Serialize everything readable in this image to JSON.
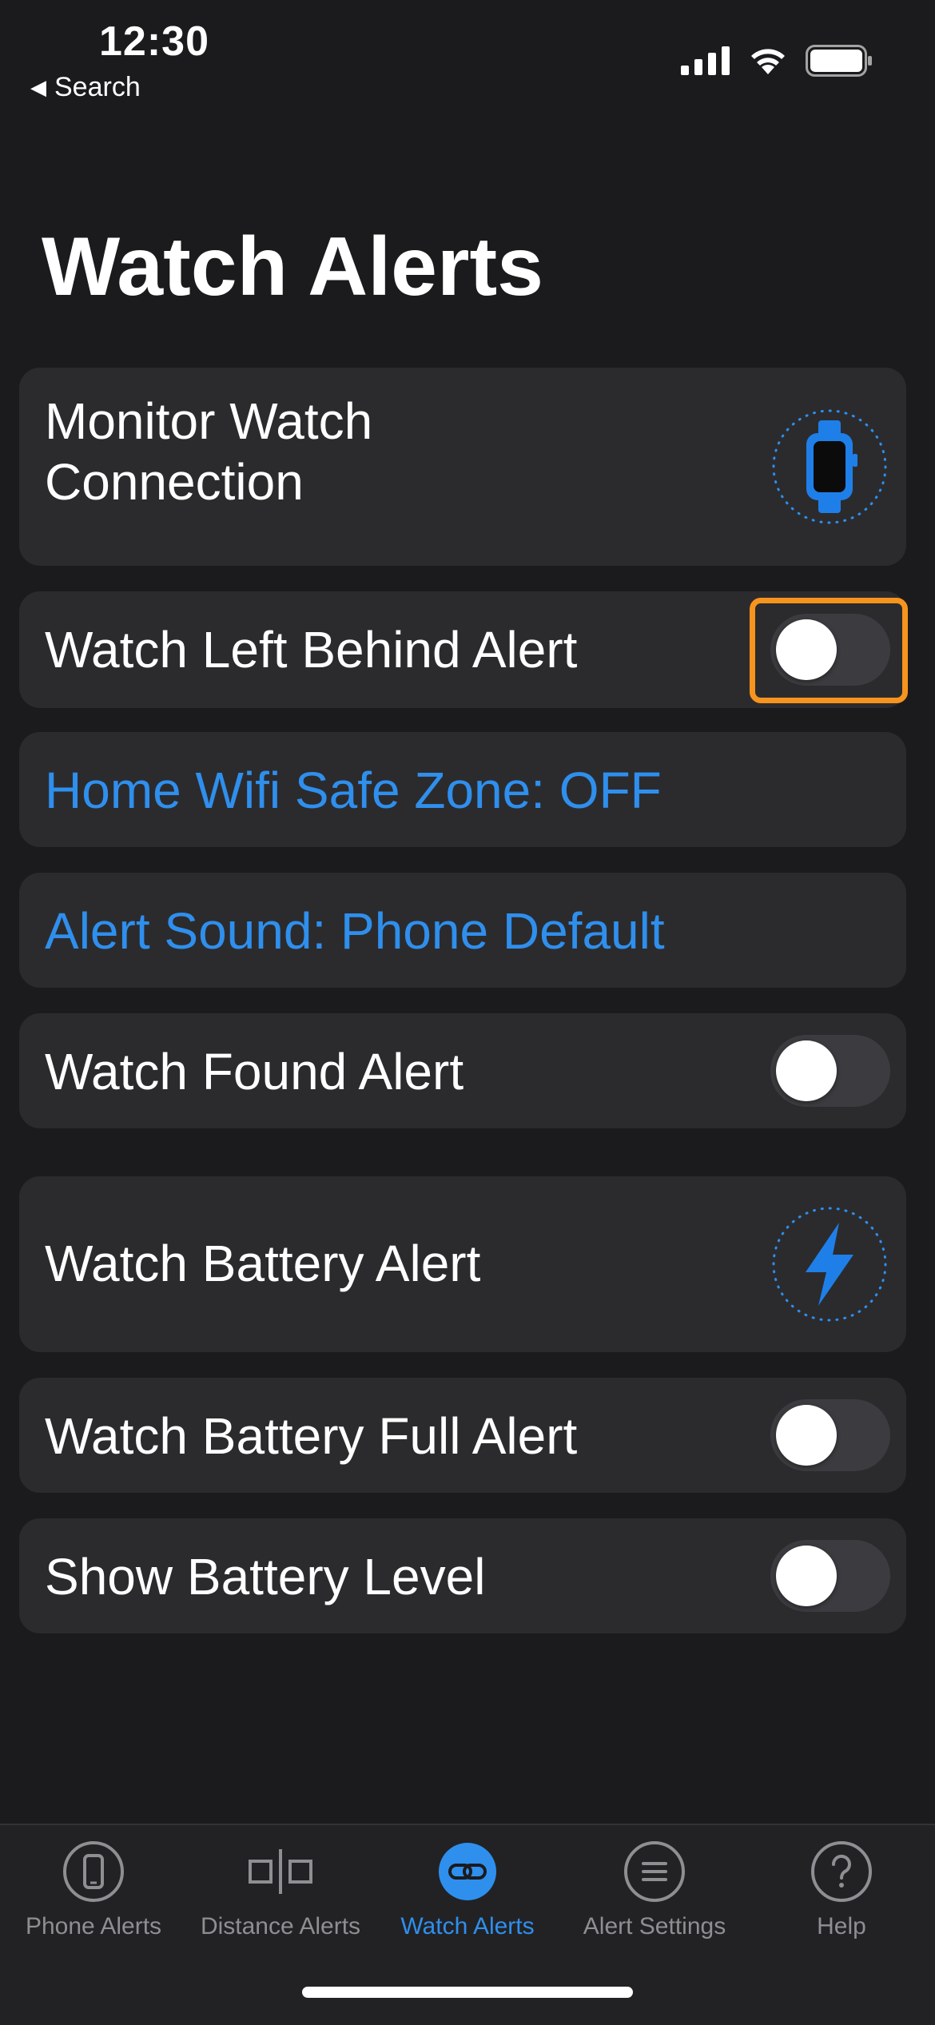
{
  "status_bar": {
    "time": "12:30",
    "back_label": "Search",
    "icons": [
      "cellular-signal-icon",
      "wifi-icon",
      "battery-icon"
    ]
  },
  "page": {
    "title": "Watch Alerts"
  },
  "rows": {
    "monitor_connection": {
      "label_line1": "Monitor Watch",
      "label_line2": "Connection",
      "icon": "watch-icon"
    },
    "left_behind": {
      "label": "Watch Left Behind Alert",
      "toggle_on": false
    },
    "home_wifi": {
      "label": "Home Wifi Safe Zone: OFF"
    },
    "alert_sound": {
      "label": "Alert Sound: Phone Default"
    },
    "found_alert": {
      "label": "Watch Found Alert",
      "toggle_on": false
    },
    "battery_alert": {
      "label": "Watch Battery Alert",
      "icon": "lightning-bolt-icon"
    },
    "battery_full": {
      "label": "Watch Battery Full Alert",
      "toggle_on": false
    },
    "show_battery": {
      "label": "Show Battery Level",
      "toggle_on": false
    }
  },
  "tab_bar": {
    "tabs": [
      {
        "label": "Phone Alerts",
        "icon": "phone-icon",
        "active": false
      },
      {
        "label": "Distance Alerts",
        "icon": "distance-icon",
        "active": false
      },
      {
        "label": "Watch Alerts",
        "icon": "link-icon",
        "active": true
      },
      {
        "label": "Alert Settings",
        "icon": "list-icon",
        "active": false
      },
      {
        "label": "Help",
        "icon": "help-icon",
        "active": false
      }
    ]
  },
  "colors": {
    "background": "#1b1b1d",
    "card": "#2b2b2e",
    "accent": "#2f8fed",
    "highlight": "#f7941d",
    "toggle_off_track": "#3c3c40"
  }
}
